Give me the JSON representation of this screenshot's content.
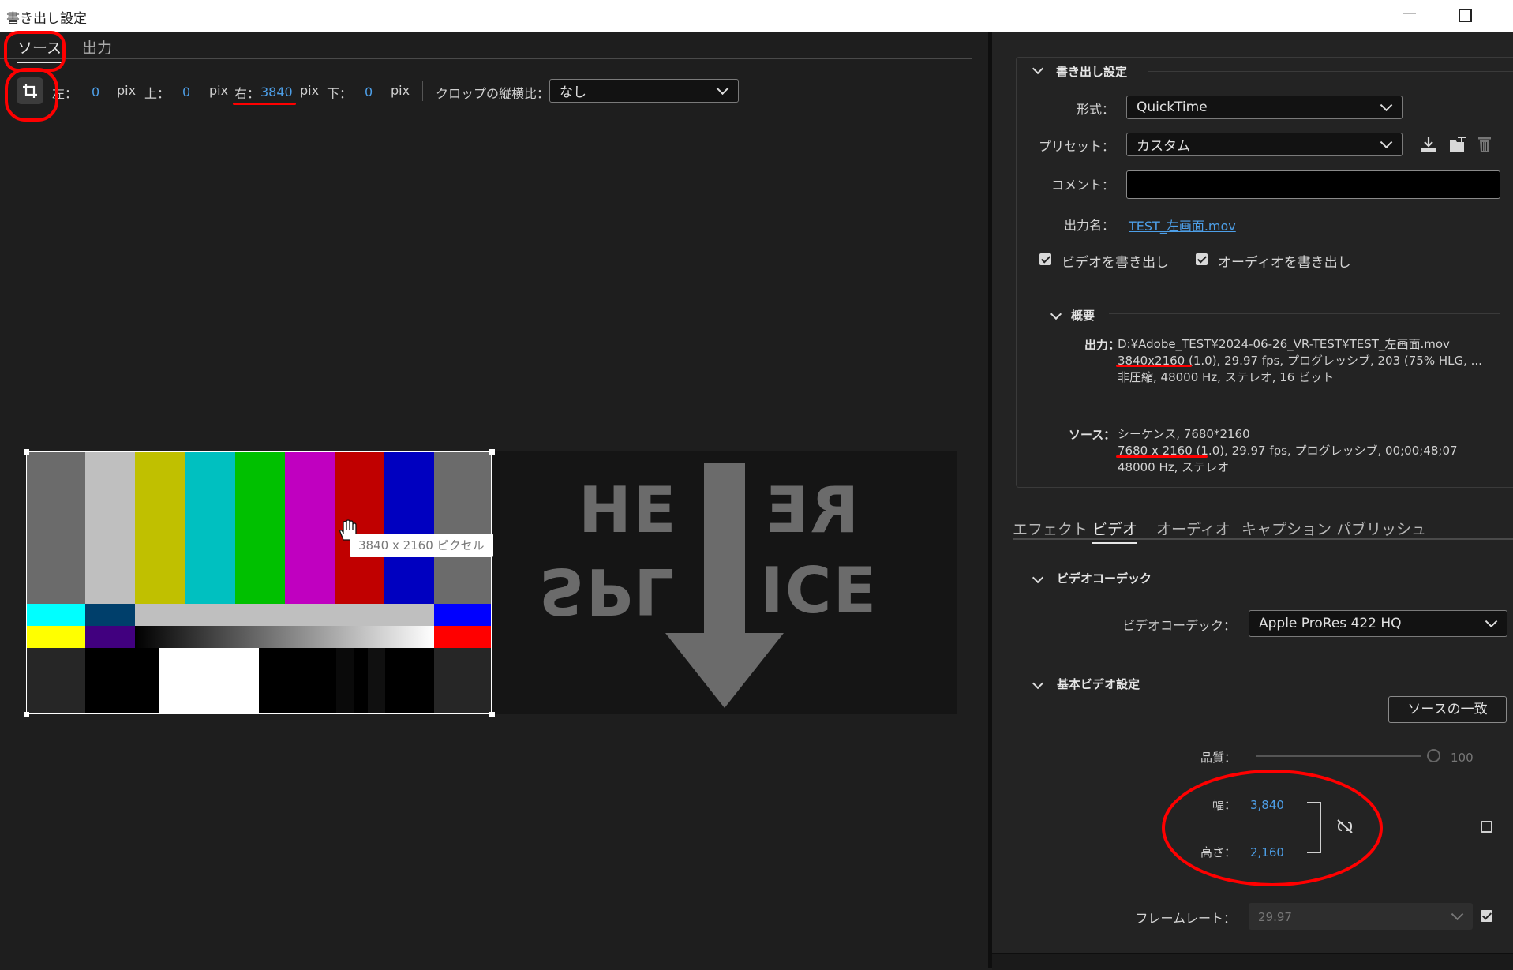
{
  "window": {
    "title": "書き出し設定"
  },
  "source_tabs": [
    {
      "label": "ソース"
    },
    {
      "label": "出力"
    }
  ],
  "crop": {
    "left_label": "左：",
    "left_value": "0",
    "left_unit": "pix",
    "top_label": "上：",
    "top_value": "0",
    "top_unit": "pix",
    "right_label": "右：",
    "right_value": "3840",
    "right_unit": "pix",
    "bottom_label": "下：",
    "bottom_value": "0",
    "bottom_unit": "pix",
    "ratio_label": "クロップの縦横比：",
    "ratio_value": "なし"
  },
  "preview": {
    "tooltip": "3840 x 2160 ピクセル",
    "slate_top_left": "HE",
    "slate_top_right": "RE",
    "slate_bottom_left": "SPL",
    "slate_bottom_right": "ICE"
  },
  "export": {
    "section_title": "書き出し設定",
    "format_label": "形式：",
    "format_value": "QuickTime",
    "preset_label": "プリセット：",
    "preset_value": "カスタム",
    "comment_label": "コメント：",
    "comment_value": "",
    "output_name_label": "出力名：",
    "output_name_value": "TEST_左画面.mov",
    "export_video_label": "ビデオを書き出し",
    "export_video_checked": true,
    "export_audio_label": "オーディオを書き出し",
    "export_audio_checked": true
  },
  "summary": {
    "title": "概要",
    "output_label": "出力：",
    "output_lines": [
      "D:¥Adobe_TEST¥2024-06-26_VR-TEST¥TEST_左画面.mov",
      "3840x2160 (1.0), 29.97 fps, プログレッシブ, 203 (75% HLG, ...",
      "非圧縮, 48000 Hz, ステレオ, 16 ビット"
    ],
    "source_label": "ソース：",
    "source_lines": [
      "シーケンス, 7680*2160",
      "7680 x 2160 (1.0), 29.97 fps, プログレッシブ, 00;00;48;07",
      "48000 Hz, ステレオ"
    ]
  },
  "settings_tabs": [
    {
      "label": "エフェクト"
    },
    {
      "label": "ビデオ"
    },
    {
      "label": "オーディオ"
    },
    {
      "label": "キャプション"
    },
    {
      "label": "パブリッシュ"
    }
  ],
  "video_codec": {
    "section_title": "ビデオコーデック",
    "codec_label": "ビデオコーデック：",
    "codec_value": "Apple ProRes 422 HQ"
  },
  "basic_video": {
    "section_title": "基本ビデオ設定",
    "match_source_button": "ソースの一致",
    "quality_label": "品質：",
    "quality_value": "100",
    "width_label": "幅：",
    "width_value": "3,840",
    "height_label": "高さ：",
    "height_value": "2,160",
    "framerate_label": "フレームレート：",
    "framerate_value": "29.97",
    "framerate_checked": true
  },
  "colors": {
    "accent_blue": "#4d9fe8",
    "annotation_red": "#ff0000"
  }
}
